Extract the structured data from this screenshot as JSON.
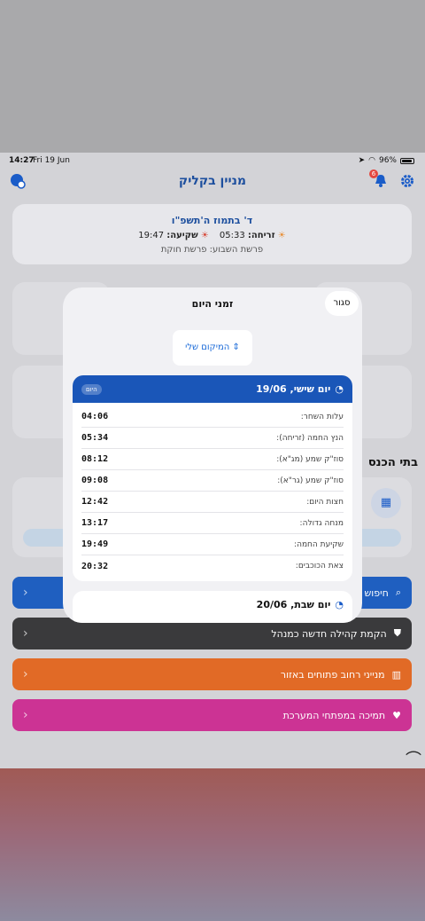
{
  "status_bar": {
    "time": "14:27",
    "date": "Fri 19 Jun",
    "battery": "96%"
  },
  "header": {
    "title": "מניין בקליק",
    "notification_count": "6"
  },
  "date_card": {
    "hebrew_date": "ד' בתמוז ה'תשפ\"ו",
    "sunrise_label": "זריחה:",
    "sunrise_time": "05:33",
    "sunset_label": "שקיעה:",
    "sunset_time": "19:47",
    "parasha": "פרשת השבוע: פרשת חוקת"
  },
  "section_title": "בתי הכנס",
  "menu": [
    {
      "label": "חיפוש",
      "color": "#1f5fc0"
    },
    {
      "label": "הקמת קהילה חדשה כמנהל",
      "color": "#3a3a3c"
    },
    {
      "label": "מנייני רחוב פתוחים באזור",
      "color": "#e16a26"
    },
    {
      "label": "תמיכה במפתחי המערכת",
      "color": "#cc3394"
    }
  ],
  "modal": {
    "title": "זמני היום",
    "close_label": "סגור",
    "location_label": "המיקום שלי",
    "today": {
      "title": "יום שישי, 19/06",
      "badge": "היום",
      "rows": [
        {
          "name": "עלות השחר:",
          "time": "04:06"
        },
        {
          "name": "הנץ החמה (זריחה):",
          "time": "05:34"
        },
        {
          "name": "סוז\"ק שמע (מג\"א):",
          "time": "08:12"
        },
        {
          "name": "סוז\"ק שמע (גר\"א):",
          "time": "09:08"
        },
        {
          "name": "חצות היום:",
          "time": "12:42"
        },
        {
          "name": "מנחה גדולה:",
          "time": "13:17"
        },
        {
          "name": "שקיעת החמה:",
          "time": "19:49"
        },
        {
          "name": "צאת הכוכבים:",
          "time": "20:32"
        }
      ]
    },
    "next": {
      "title": "יום שבת, 20/06"
    }
  }
}
